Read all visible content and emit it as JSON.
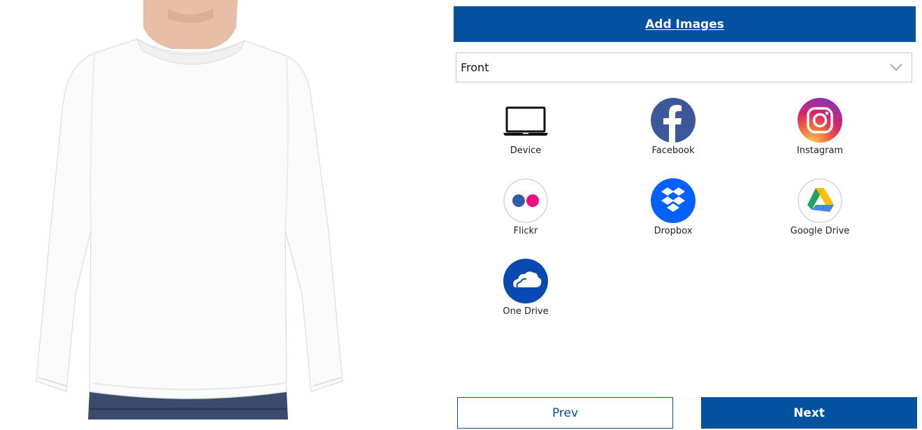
{
  "toolbar": {
    "add_images_label": "Add Images"
  },
  "side_select": {
    "value": "Front"
  },
  "sources": [
    {
      "label": "Device",
      "icon": "laptop-icon"
    },
    {
      "label": "Facebook",
      "icon": "facebook-icon"
    },
    {
      "label": "Instagram",
      "icon": "instagram-icon"
    },
    {
      "label": "Flickr",
      "icon": "flickr-icon"
    },
    {
      "label": "Dropbox",
      "icon": "dropbox-icon"
    },
    {
      "label": "Google Drive",
      "icon": "google-drive-icon"
    },
    {
      "label": "One Drive",
      "icon": "onedrive-icon"
    }
  ],
  "nav": {
    "prev_label": "Prev",
    "next_label": "Next"
  },
  "colors": {
    "accent": "#03519f",
    "facebook": "#3b5998",
    "dropbox": "#0061fe",
    "onedrive": "#094ab2"
  }
}
